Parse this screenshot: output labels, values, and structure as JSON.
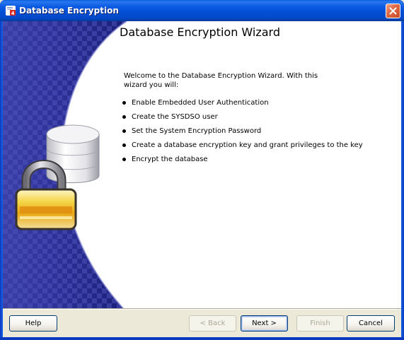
{
  "window": {
    "title": "Database Encryption",
    "close_icon": "close-icon",
    "app_icon": "oracle-app-icon"
  },
  "main": {
    "heading": "Database Encryption Wizard",
    "intro": "Welcome to the Database Encryption Wizard. With this wizard you will:",
    "steps": [
      "Enable Embedded User Authentication",
      "Create the SYSDSO user",
      "Set the System Encryption Password",
      "Create a database encryption key and grant privileges to the key",
      "Encrypt the database"
    ],
    "artwork": "database-lock-illustration"
  },
  "buttons": {
    "help": "Help",
    "back": "< Back",
    "next": "Next >",
    "finish": "Finish",
    "cancel": "Cancel"
  },
  "colors": {
    "titlebar": "#0350d6",
    "side_panel": "#1f2a8c",
    "lock_body": "#f5c518"
  }
}
